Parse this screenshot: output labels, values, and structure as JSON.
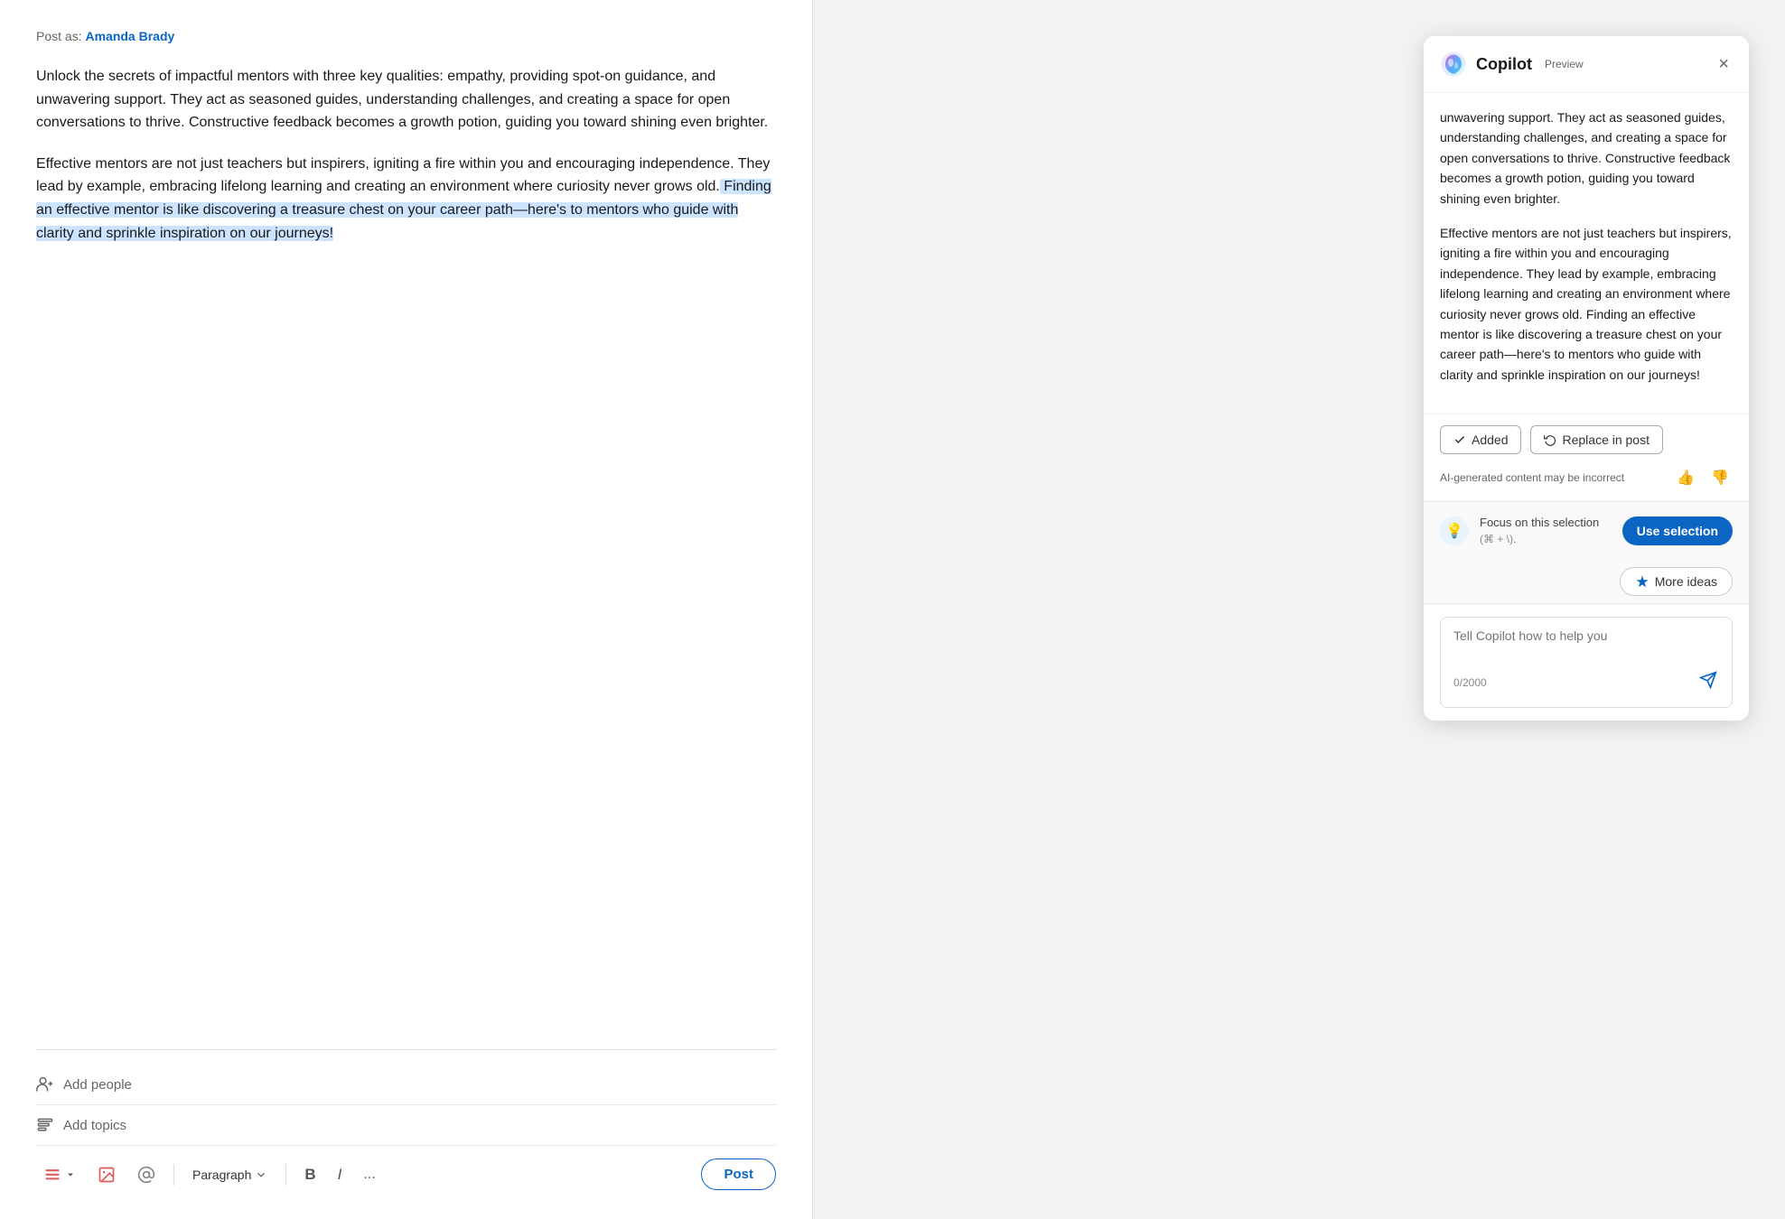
{
  "postAs": {
    "label": "Post as:",
    "name": "Amanda Brady"
  },
  "post": {
    "paragraph1": "Unlock the secrets of impactful mentors with three key qualities: empathy, providing spot-on guidance, and unwavering support. They act as seasoned guides, understanding challenges, and creating a space for open conversations to thrive. Constructive feedback becomes a growth potion, guiding you toward shining even brighter.",
    "paragraph2_normal": "Effective mentors are not just teachers but inspirers, igniting a fire within you and encouraging independence. They lead by example, embracing lifelong learning and creating an environment where curiosity never grows old.",
    "paragraph2_highlighted": " Finding an effective mentor is like discovering a treasure chest on your career path—here's to mentors who guide with clarity and sprinkle inspiration on our journeys!"
  },
  "footer": {
    "addPeople": "Add people",
    "addTopics": "Add topics",
    "postButton": "Post",
    "paragraphLabel": "Paragraph",
    "boldLabel": "B",
    "italicLabel": "I",
    "moreLabel": "..."
  },
  "copilot": {
    "title": "Copilot",
    "previewBadge": "Preview",
    "closeLabel": "×",
    "content_p1": "unwavering support. They act as seasoned guides, understanding challenges, and creating a space for open conversations to thrive. Constructive feedback becomes a growth potion, guiding you toward shining even brighter.",
    "content_p2": "Effective mentors are not just teachers but inspirers, igniting a fire within you and encouraging independence. They lead by example, embracing lifelong learning and creating an environment where curiosity never grows old. Finding an effective mentor is like discovering a treasure chest on your career path—here's to mentors who guide with clarity and sprinkle inspiration on our journeys!",
    "addedButton": "Added",
    "replaceInPost": "Replace in post",
    "feedbackLabel": "AI-generated content may be incorrect",
    "focusLabel": "Focus on this selection",
    "focusShortcut": "(⌘ + \\).",
    "useSelectionButton": "Use selection",
    "moreIdeasButton": "More ideas",
    "inputPlaceholder": "Tell Copilot how to help you",
    "charCount": "0/2000",
    "sendButton": "➤"
  }
}
